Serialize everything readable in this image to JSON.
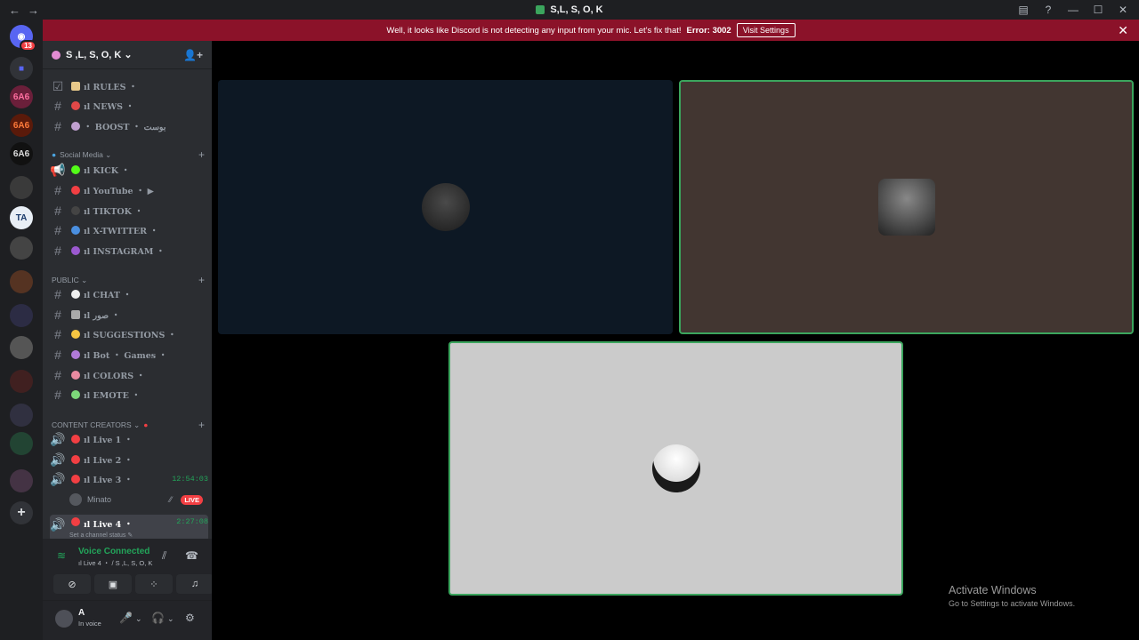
{
  "window": {
    "title": "S,L, S, O, K",
    "back_icon": "arrow-left-icon",
    "forward_icon": "arrow-right-icon"
  },
  "banner": {
    "message": "Well, it looks like Discord is not detecting any input from your mic. Let's fix that!",
    "error": "Error: 3002",
    "button": "Visit Settings",
    "close": "✕"
  },
  "guilds": {
    "dm_badge": "13",
    "items": [
      "6A6",
      "6A6",
      "6A6",
      "TA"
    ]
  },
  "server": {
    "name": "S ,L, S, O, K ⌄",
    "channels_top": [
      {
        "name": "ıl RULES ・"
      },
      {
        "name": "ıl NEWS ・"
      },
      {
        "name": "・ BOOST ・ بوست"
      }
    ],
    "categories": [
      {
        "name": "Social Media ⌄"
      },
      {
        "name": "PUBLIC ⌄"
      },
      {
        "name": "CONTENT CREATORS ⌄"
      }
    ],
    "social": [
      {
        "name": "ıl KICK ・"
      },
      {
        "name": "ıl YouTube ・ ▶"
      },
      {
        "name": "ıl TIKTOK ・"
      },
      {
        "name": "ıl X-TWITTER ・"
      },
      {
        "name": "ıl INSTAGRAM ・"
      }
    ],
    "public": [
      {
        "name": "ıl CHAT ・"
      },
      {
        "name": "ıl صور ・"
      },
      {
        "name": "ıl SUGGESTIONS ・"
      },
      {
        "name": "ıl Bot ・ Games ・"
      },
      {
        "name": "ıl COLORS ・"
      },
      {
        "name": "ıl EMOTE ・"
      }
    ],
    "creators": [
      {
        "name": "ıl Live 1 ・"
      },
      {
        "name": "ıl Live 2 ・"
      },
      {
        "name": "ıl Live 3 ・",
        "time": "12:54:03"
      },
      {
        "name": "ıl Live 4 ・",
        "time": "2:27:08"
      }
    ],
    "live_user": "Minato",
    "live_badge": "LIVE",
    "status_hint": "Set a channel status ✎"
  },
  "voice": {
    "title": "Voice Connected",
    "channel": "ıl Live 4 ・ / S ,L, S, O, K"
  },
  "user": {
    "name": "A",
    "status": "In voice"
  },
  "watermark": {
    "title": "Activate Windows",
    "subtitle": "Go to Settings to activate Windows."
  },
  "colors": {
    "banner": "#8b1229",
    "speaking": "#3ba55d",
    "sidebar": "#2b2d31"
  }
}
